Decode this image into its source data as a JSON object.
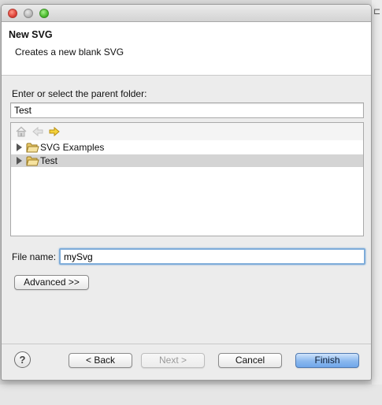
{
  "dialog": {
    "header_title": "New SVG",
    "header_description": "Creates a new blank SVG"
  },
  "folder": {
    "label": "Enter or select the parent folder:",
    "value": "Test"
  },
  "tree": {
    "toolbar": [
      "home-icon",
      "back-arrow-icon",
      "forward-arrow-icon"
    ],
    "items": [
      {
        "label": "SVG Examples",
        "selected": false
      },
      {
        "label": "Test",
        "selected": true
      }
    ]
  },
  "file": {
    "label": "File name:",
    "value": "mySvg"
  },
  "buttons": {
    "advanced": "Advanced >>",
    "help": "?",
    "back": "< Back",
    "next": "Next >",
    "cancel": "Cancel",
    "finish": "Finish"
  },
  "colors": {
    "accent": "#7eacd9",
    "primary_button": "#8ab8ee",
    "selection": "#d4d4d4"
  }
}
